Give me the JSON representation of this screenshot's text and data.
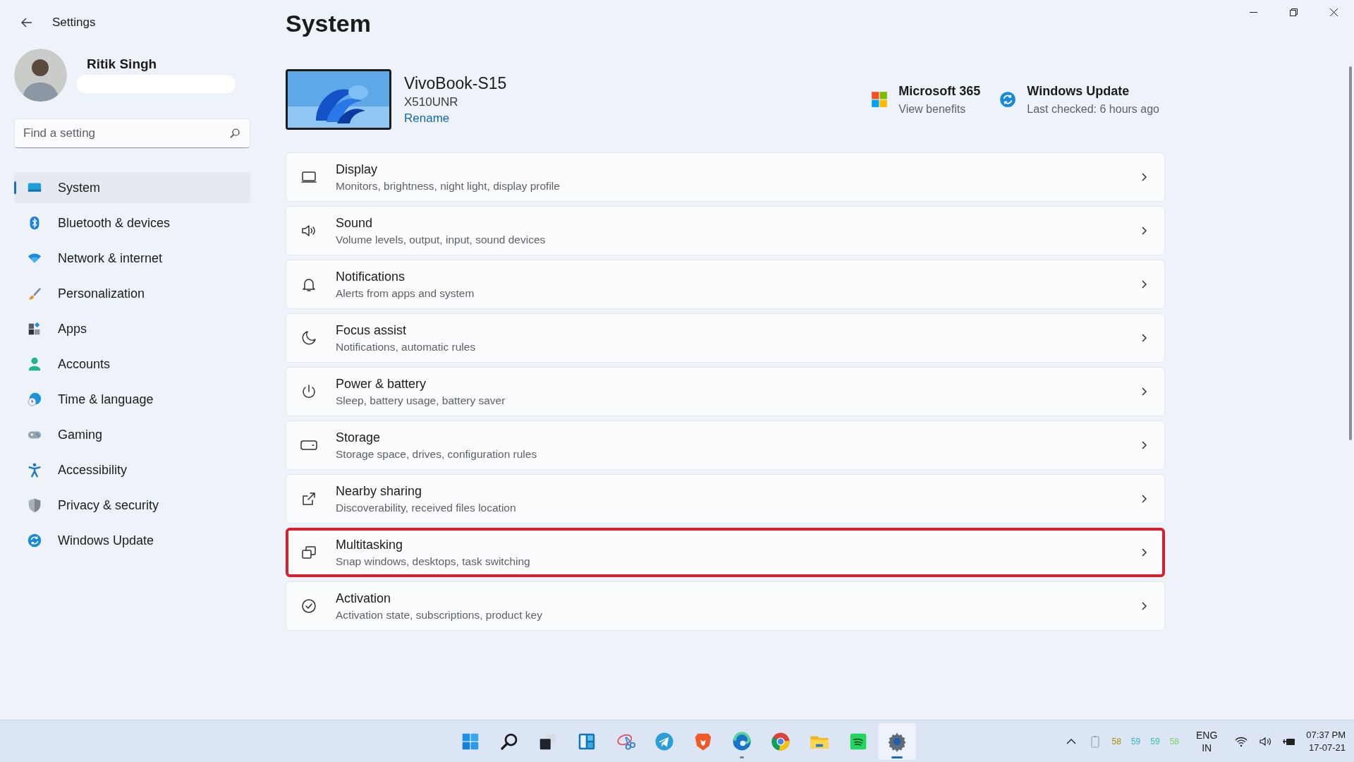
{
  "window": {
    "title": "Settings"
  },
  "user": {
    "name": "Ritik Singh"
  },
  "search": {
    "placeholder": "Find a setting"
  },
  "sidebar": {
    "items": [
      {
        "label": "System",
        "kind": "system",
        "selected": true
      },
      {
        "label": "Bluetooth & devices",
        "kind": "bluetooth",
        "selected": false
      },
      {
        "label": "Network & internet",
        "kind": "network",
        "selected": false
      },
      {
        "label": "Personalization",
        "kind": "personalization",
        "selected": false
      },
      {
        "label": "Apps",
        "kind": "apps",
        "selected": false
      },
      {
        "label": "Accounts",
        "kind": "accounts",
        "selected": false
      },
      {
        "label": "Time & language",
        "kind": "time",
        "selected": false
      },
      {
        "label": "Gaming",
        "kind": "gaming",
        "selected": false
      },
      {
        "label": "Accessibility",
        "kind": "accessibility",
        "selected": false
      },
      {
        "label": "Privacy & security",
        "kind": "privacy",
        "selected": false
      },
      {
        "label": "Windows Update",
        "kind": "update",
        "selected": false
      }
    ]
  },
  "page": {
    "title": "System"
  },
  "device": {
    "name": "VivoBook-S15",
    "model": "X510UNR",
    "rename": "Rename"
  },
  "promos": [
    {
      "kind": "microsoft365",
      "title": "Microsoft 365",
      "subtitle": "View benefits"
    },
    {
      "kind": "update",
      "title": "Windows Update",
      "subtitle": "Last checked: 6 hours ago"
    }
  ],
  "cards": [
    {
      "kind": "display",
      "title": "Display",
      "description": "Monitors, brightness, night light, display profile",
      "highlighted": false
    },
    {
      "kind": "sound",
      "title": "Sound",
      "description": "Volume levels, output, input, sound devices",
      "highlighted": false
    },
    {
      "kind": "notifications",
      "title": "Notifications",
      "description": "Alerts from apps and system",
      "highlighted": false
    },
    {
      "kind": "focus",
      "title": "Focus assist",
      "description": "Notifications, automatic rules",
      "highlighted": false
    },
    {
      "kind": "power",
      "title": "Power & battery",
      "description": "Sleep, battery usage, battery saver",
      "highlighted": false
    },
    {
      "kind": "storage",
      "title": "Storage",
      "description": "Storage space, drives, configuration rules",
      "highlighted": false
    },
    {
      "kind": "nearby",
      "title": "Nearby sharing",
      "description": "Discoverability, received files location",
      "highlighted": false
    },
    {
      "kind": "multitasking",
      "title": "Multitasking",
      "description": "Snap windows, desktops, task switching",
      "highlighted": true
    },
    {
      "kind": "activation",
      "title": "Activation",
      "description": "Activation state, subscriptions, product key",
      "highlighted": false
    }
  ],
  "taskbar": {
    "apps": [
      {
        "kind": "start",
        "selected": false,
        "running": false
      },
      {
        "kind": "search",
        "selected": false,
        "running": false
      },
      {
        "kind": "taskview",
        "selected": false,
        "running": false
      },
      {
        "kind": "widgets",
        "selected": false,
        "running": false
      },
      {
        "kind": "snip",
        "selected": false,
        "running": false
      },
      {
        "kind": "telegram",
        "selected": false,
        "running": false
      },
      {
        "kind": "brave",
        "selected": false,
        "running": false
      },
      {
        "kind": "edge",
        "selected": false,
        "running": true
      },
      {
        "kind": "chrome",
        "selected": false,
        "running": false
      },
      {
        "kind": "explorer",
        "selected": false,
        "running": false
      },
      {
        "kind": "spotify",
        "selected": false,
        "running": false
      },
      {
        "kind": "settings",
        "selected": true,
        "running": true
      }
    ]
  },
  "tray": {
    "readings": [
      {
        "text": "58",
        "color": "#a89400"
      },
      {
        "text": "59",
        "color": "#35b3c8"
      },
      {
        "text": "59",
        "color": "#33c6a4"
      },
      {
        "text": "58",
        "color": "#7ed35c"
      }
    ],
    "language": {
      "line1": "ENG",
      "line2": "IN"
    },
    "clock": {
      "time": "07:37 PM",
      "date": "17-07-21"
    }
  }
}
